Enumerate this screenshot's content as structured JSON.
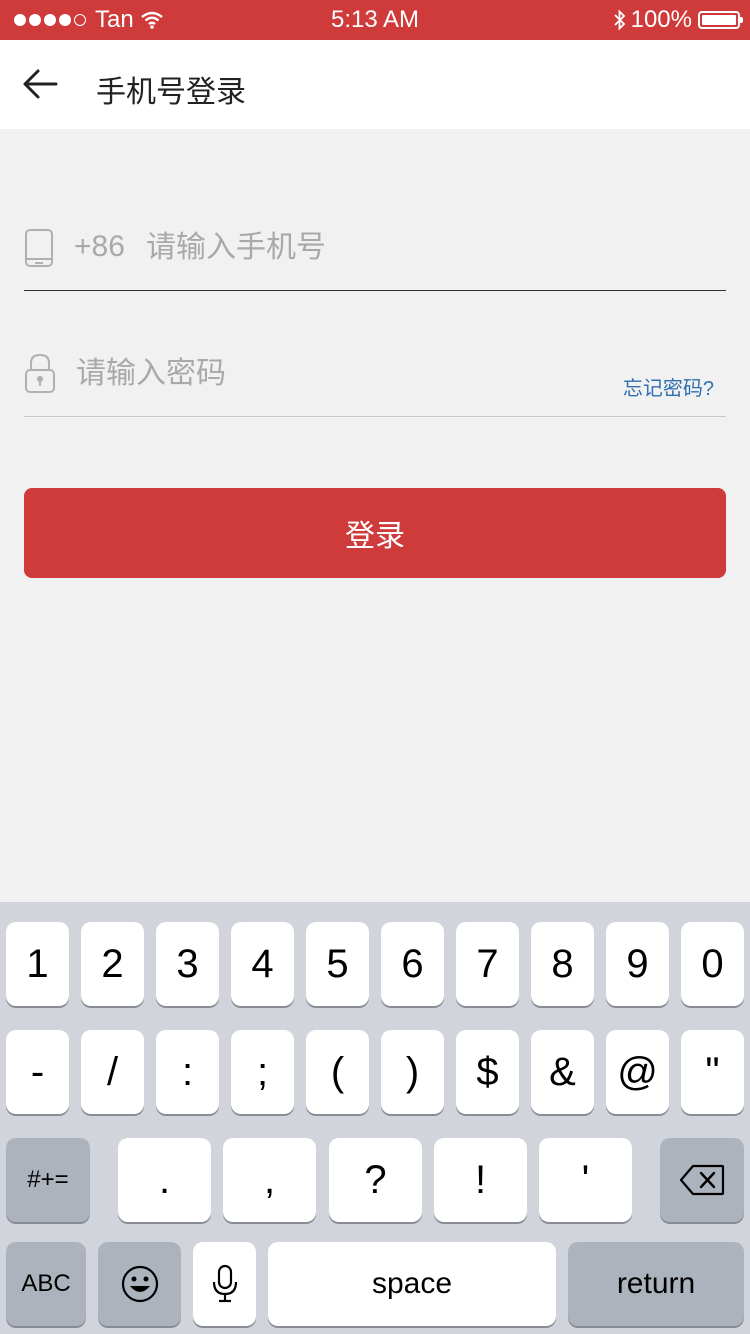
{
  "status_bar": {
    "carrier": "Tan",
    "time": "5:13 AM",
    "battery": "100%",
    "signal_dots_filled": 4,
    "signal_dots_total": 5
  },
  "nav": {
    "title": "手机号登录"
  },
  "phone_field": {
    "prefix": "+86",
    "placeholder": "请输入手机号"
  },
  "password_field": {
    "placeholder": "请输入密码",
    "forgot_link": "忘记密码?"
  },
  "login_button": "登录",
  "keyboard": {
    "row1": [
      "1",
      "2",
      "3",
      "4",
      "5",
      "6",
      "7",
      "8",
      "9",
      "0"
    ],
    "row2": [
      "-",
      "/",
      ":",
      ";",
      "(",
      ")",
      "$",
      "&",
      "@",
      "\""
    ],
    "row3_left": "#+=",
    "row3": [
      ".",
      ",",
      "?",
      "!",
      "'"
    ],
    "row4_abc": "ABC",
    "row4_space": "space",
    "row4_return": "return"
  },
  "colors": {
    "brand_red": "#cf3a3a",
    "link_blue": "#2f6fb2",
    "background": "#f1f1f1",
    "keyboard_bg": "#d1d4db"
  }
}
